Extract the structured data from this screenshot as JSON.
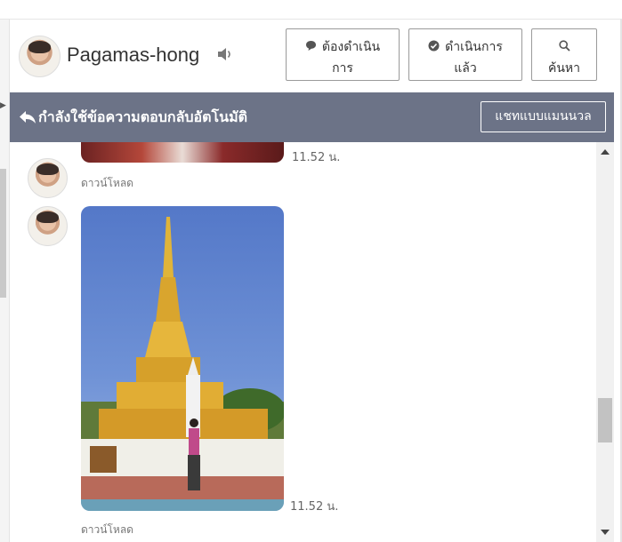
{
  "contact": {
    "name": "Pagamas-hong"
  },
  "header": {
    "buttons": [
      {
        "line1": "ต้องดำเนิน",
        "line2": "การ"
      },
      {
        "line1": "ดำเนินการ",
        "line2": "แล้ว"
      },
      {
        "line1": "",
        "line2": "ค้นหา"
      }
    ]
  },
  "banner": {
    "text": "กำลังใช้ข้อความตอบกลับอัตโนมัติ",
    "manual_button": "แชทแบบแมนนวล"
  },
  "messages": [
    {
      "time": "11.52 น.",
      "download": "ดาวน์โหลด"
    },
    {
      "time": "11.52 น.",
      "download": "ดาวน์โหลด"
    }
  ],
  "colors": {
    "banner": "#6c7387",
    "accent": "#3b4a6b"
  },
  "icons": [
    "speaker-icon",
    "chat-bubble-icon",
    "check-circle-icon",
    "search-icon",
    "reply-arrow-icon"
  ]
}
